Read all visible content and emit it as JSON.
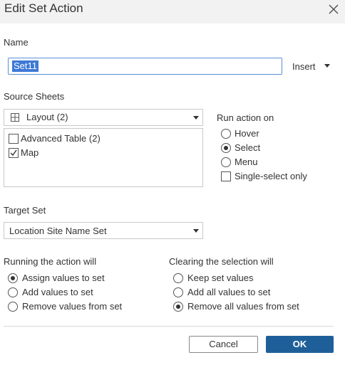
{
  "dialog": {
    "title": "Edit Set Action"
  },
  "name_section": {
    "label": "Name",
    "value": "Set11",
    "insert_label": "Insert"
  },
  "source_sheets": {
    "label": "Source Sheets",
    "selected": "Layout (2)",
    "items": [
      {
        "label": "Advanced Table (2)",
        "checked": false
      },
      {
        "label": "Map",
        "checked": true
      }
    ]
  },
  "run_action_on": {
    "label": "Run action on",
    "options": [
      {
        "label": "Hover",
        "selected": false
      },
      {
        "label": "Select",
        "selected": true
      },
      {
        "label": "Menu",
        "selected": false
      }
    ],
    "single_select_label": "Single-select only"
  },
  "target_set": {
    "label": "Target Set",
    "selected": "Location Site Name Set"
  },
  "running_action": {
    "label": "Running the action will",
    "options": [
      {
        "label": "Assign values to set",
        "selected": true
      },
      {
        "label": "Add values to set",
        "selected": false
      },
      {
        "label": "Remove values from set",
        "selected": false
      }
    ]
  },
  "clearing_selection": {
    "label": "Clearing the selection will",
    "options": [
      {
        "label": "Keep set values",
        "selected": false
      },
      {
        "label": "Add all values to set",
        "selected": false
      },
      {
        "label": "Remove all values from set",
        "selected": true
      }
    ]
  },
  "buttons": {
    "cancel": "Cancel",
    "ok": "OK"
  },
  "colors": {
    "accent": "#1f5f99",
    "selection": "#3d79d6"
  }
}
